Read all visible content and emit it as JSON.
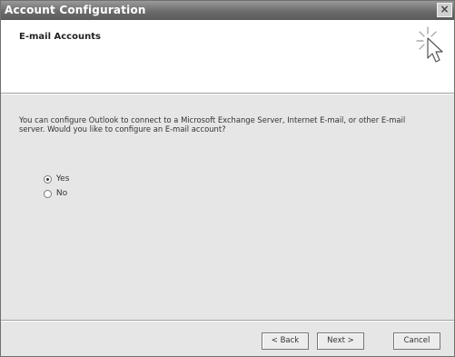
{
  "window": {
    "title": "Account Configuration",
    "close_symbol": "×"
  },
  "header": {
    "title": "E-mail Accounts",
    "icon": "wizard-cursor-icon"
  },
  "content": {
    "question": "You can configure Outlook to connect to a Microsoft Exchange Server, Internet E-mail, or other E-mail server. Would you like to configure an E-mail account?",
    "options": [
      {
        "label": "Yes",
        "selected": true
      },
      {
        "label": "No",
        "selected": false
      }
    ]
  },
  "footer": {
    "back_label": "< Back",
    "next_label": "Next >",
    "cancel_label": "Cancel"
  }
}
